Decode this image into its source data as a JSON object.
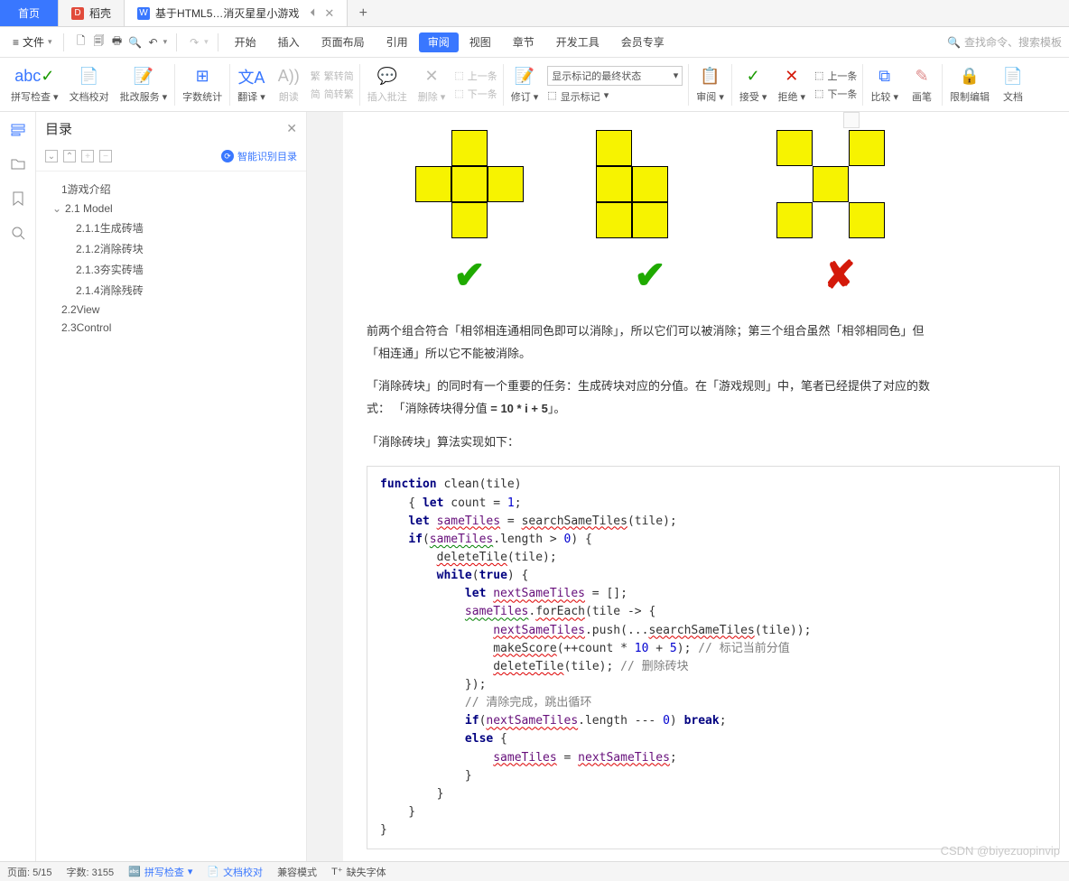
{
  "tabs": {
    "home": "首页",
    "docker": "稻壳",
    "doc": "基于HTML5…消灭星星小游戏"
  },
  "file_label": "文件",
  "menu": {
    "start": "开始",
    "insert": "插入",
    "layout": "页面布局",
    "ref": "引用",
    "review": "审阅",
    "view": "视图",
    "chapter": "章节",
    "devtools": "开发工具",
    "vip": "会员专享"
  },
  "search_placeholder": "查找命令、搜索模板",
  "ribbon": {
    "spell": "拼写检查",
    "doccheck": "文档校对",
    "approve": "批改服务",
    "wordcount": "字数统计",
    "translate": "翻译",
    "read": "朗读",
    "s2t": "繁转简",
    "t2s": "简转繁",
    "insertcomment": "插入批注",
    "delete": "删除",
    "prev": "上一条",
    "next": "下一条",
    "track": "修订",
    "combo": "显示标记的最终状态",
    "showmark": "显示标记",
    "accept_v": "审阅",
    "accept": "接受",
    "reject": "拒绝",
    "prev2": "上一条",
    "next2": "下一条",
    "compare": "比较",
    "pen": "画笔",
    "restrict": "限制编辑",
    "docpart": "文档"
  },
  "toc": {
    "title": "目录",
    "auto": "智能识别目录",
    "items": [
      "1游戏介绍",
      "2.1 Model",
      "2.1.1生成砖墙",
      "2.1.2消除砖块",
      "2.1.3夯实砖墙",
      "2.1.4消除残砖",
      "2.2View",
      "2.3Control"
    ]
  },
  "doc": {
    "p1": "前两个组合符合「相邻相连通相同色即可以消除」，所以它们可以被消除；第三个组合虽然「相邻相同色」但",
    "p1b": "「相连通」所以它不能被消除。",
    "p2a": "「消除砖块」的同时有一个重要的任务：生成砖块对应的分值。在「游戏规则」中，笔者已经提供了对应的数",
    "p2b": "式： 「消除砖块得分值 ",
    "formula": "= 10 * i + 5",
    "p2c": "」。",
    "p3": "「消除砖块」算法实现如下：",
    "code": {
      "l1a": "function",
      "l1b": " clean(tile)",
      "l2a": "    { ",
      "l2b": "let",
      "l2c": " count = ",
      "l2d": "1",
      "l2e": ";",
      "l3a": "    ",
      "l3b": "let",
      "l3c": " ",
      "l3d": "sameTiles",
      "l3e": " = ",
      "l3f": "searchSameTiles",
      "l3g": "(tile);",
      "l4a": "    ",
      "l4b": "if",
      "l4c": "(",
      "l4d": "sameTiles",
      "l4e": ".length > ",
      "l4f": "0",
      "l4g": ") {",
      "l5a": "        ",
      "l5b": "deleteTile",
      "l5c": "(tile);",
      "l6a": "        ",
      "l6b": "while",
      "l6c": "(",
      "l6d": "true",
      "l6e": ") {",
      "l7a": "            ",
      "l7b": "let",
      "l7c": " ",
      "l7d": "nextSameTiles",
      "l7e": " = [];",
      "l8a": "            ",
      "l8b": "sameTiles",
      "l8c": ".",
      "l8d": "forEach",
      "l8e": "(tile -> {",
      "l9a": "                ",
      "l9b": "nextSameTiles",
      "l9c": ".push(...",
      "l9d": "searchSameTiles",
      "l9e": "(tile));",
      "l10a": "                ",
      "l10b": "makeScore",
      "l10c": "(++count * ",
      "l10d": "10",
      "l10e": " + ",
      "l10f": "5",
      "l10g": "); ",
      "l10h": "// 标记当前分值",
      "l11a": "                ",
      "l11b": "deleteTile",
      "l11c": "(tile); ",
      "l11d": "// 删除砖块",
      "l12": "            });",
      "l13a": "            ",
      "l13b": "// 清除完成，跳出循环",
      "l14a": "            ",
      "l14b": "if",
      "l14c": "(",
      "l14d": "nextSameTiles",
      "l14e": ".length --- ",
      "l14f": "0",
      "l14g": ") ",
      "l14h": "break",
      "l14i": ";",
      "l15a": "            ",
      "l15b": "else",
      "l15c": " {",
      "l16a": "                ",
      "l16b": "sameTiles",
      "l16c": " = ",
      "l16d": "nextSameTiles",
      "l16e": ";",
      "l17": "            }",
      "l18": "        }",
      "l19": "    }",
      "l20": "}"
    }
  },
  "status": {
    "page": "页面: 5/15",
    "words": "字数: 3155",
    "spell": "拼写检查",
    "doccheck": "文档校对",
    "compat": "兼容模式",
    "missingfont": "缺失字体"
  },
  "watermark": "CSDN @biyezuopinvip"
}
